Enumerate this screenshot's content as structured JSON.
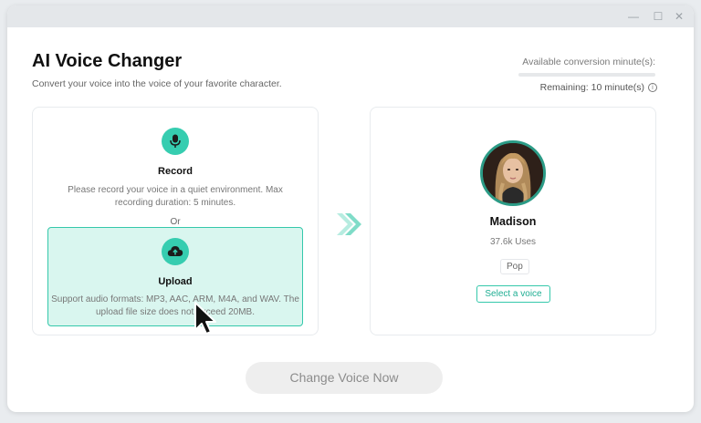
{
  "window": {
    "controls": {
      "minimize": "—",
      "maximize": "☐",
      "close": "✕"
    }
  },
  "header": {
    "title": "AI Voice Changer",
    "subtitle": "Convert your voice into the voice of your favorite character."
  },
  "quota": {
    "label": "Available conversion minute(s):",
    "remaining": "Remaining: 10 minute(s)",
    "used_fraction": 0,
    "info_icon": "info-icon"
  },
  "record": {
    "icon": "microphone-icon",
    "title": "Record",
    "description": "Please record your voice in a quiet environment. Max recording duration: 5 minutes."
  },
  "or_text": "Or",
  "upload": {
    "icon": "cloud-upload-icon",
    "title": "Upload",
    "description": "Support audio formats: MP3, AAC, ARM, M4A, and WAV. The upload file size does not exceed 20MB."
  },
  "voice": {
    "name": "Madison",
    "uses": "37.6k Uses",
    "tag": "Pop",
    "select_label": "Select a voice"
  },
  "action": {
    "change_label": "Change Voice Now"
  },
  "colors": {
    "accent": "#36cdb0",
    "accent_dark": "#1fae93",
    "upload_bg": "#d9f6ef"
  }
}
